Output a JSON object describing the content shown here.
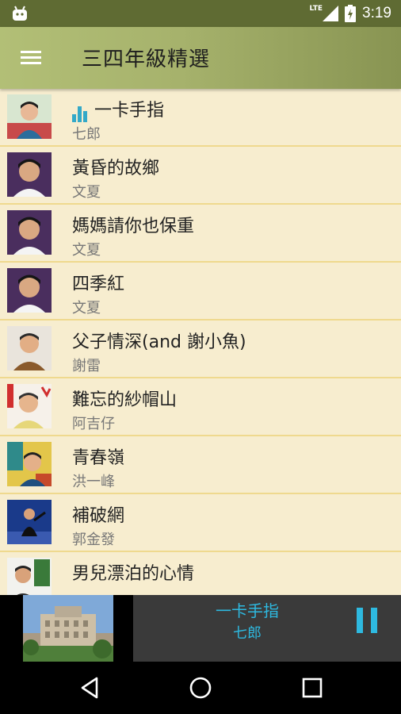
{
  "status_bar": {
    "network": "LTE",
    "time": "3:19",
    "icons": [
      "android-icon",
      "signal-icon",
      "battery-icon"
    ]
  },
  "app_bar": {
    "title": "三四年級精選",
    "menu_icon": "hamburger-menu-icon"
  },
  "songs": [
    {
      "title": "一卡手指",
      "artist": "七郎",
      "playing": true
    },
    {
      "title": "黃昏的故鄉",
      "artist": "文夏",
      "playing": false
    },
    {
      "title": "媽媽請你也保重",
      "artist": "文夏",
      "playing": false
    },
    {
      "title": "四季紅",
      "artist": "文夏",
      "playing": false
    },
    {
      "title": "父子情深(and 謝小魚)",
      "artist": "謝雷",
      "playing": false
    },
    {
      "title": "難忘的紗帽山",
      "artist": "阿吉仔",
      "playing": false
    },
    {
      "title": "青春嶺",
      "artist": "洪一峰",
      "playing": false
    },
    {
      "title": "補破網",
      "artist": "郭金發",
      "playing": false
    },
    {
      "title": "男兒漂泊的心情",
      "artist": "",
      "playing": false
    }
  ],
  "now_playing": {
    "title": "一卡手指",
    "artist": "七郎",
    "control_icon": "pause-icon"
  },
  "nav_bar": {
    "icons": [
      "back-icon",
      "home-icon",
      "recents-icon"
    ]
  },
  "colors": {
    "status_bar": "#5f6b33",
    "app_bar": "#a6b26c",
    "list_background": "#f7edcf",
    "row_divider": "#efd98e",
    "accent": "#2eb9e0"
  }
}
